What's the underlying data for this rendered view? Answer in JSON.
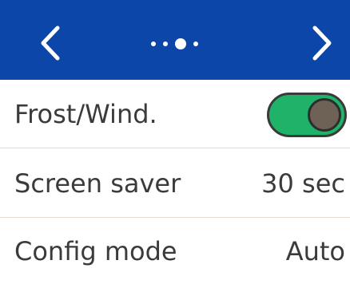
{
  "header": {
    "prev_icon": "chevron-left-icon",
    "next_icon": "chevron-right-icon",
    "page_indicator": {
      "total": 4,
      "active": 3
    },
    "background_color": "#0b46a8"
  },
  "settings": [
    {
      "label": "Frost/Wind.",
      "control": "toggle",
      "toggle_on": true
    },
    {
      "label": "Screen saver",
      "value": "30 sec"
    },
    {
      "label": "Config mode",
      "value": "Auto"
    }
  ],
  "colors": {
    "toggle_on": "#1fb36a",
    "text": "#3b3b3b",
    "divider": "#e6dcd2"
  }
}
